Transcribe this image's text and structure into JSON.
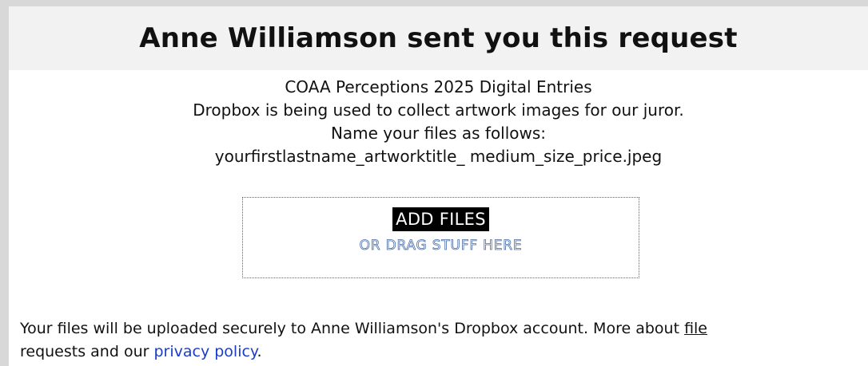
{
  "header": {
    "title": "Anne Williamson sent you this request"
  },
  "description": {
    "lines": [
      "COAA Perceptions 2025 Digital Entries",
      "Dropbox is being used to collect artwork images for our juror.",
      "Name your files as follows:",
      "yourfirstlastname_artworktitle_ medium_size_price.jpeg"
    ]
  },
  "dropzone": {
    "add_files_label": "ADD FILES",
    "drag_label": "OR DRAG STUFF HERE"
  },
  "footer": {
    "text_before": "Your files will be uploaded securely to Anne Williamson's Dropbox account. More about ",
    "file_link": "file",
    "text_middle": " requests and our ",
    "privacy_link": "privacy policy",
    "text_after": "."
  },
  "colors": {
    "header_bg": "#f2f2f2",
    "link_blue": "#1a3ccc",
    "page_bg": "#d8d8d8"
  }
}
